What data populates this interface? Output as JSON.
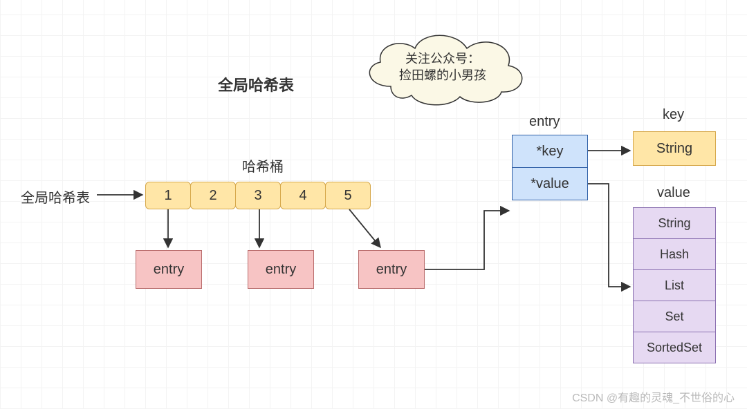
{
  "title": "全局哈希表",
  "cloud": {
    "line1": "关注公众号：",
    "line2": "捡田螺的小男孩"
  },
  "left_label": "全局哈希表",
  "bucket_label": "哈希桶",
  "buckets": [
    "1",
    "2",
    "3",
    "4",
    "5"
  ],
  "entries": [
    "entry",
    "entry",
    "entry"
  ],
  "entry_struct": {
    "heading": "entry",
    "key": "*key",
    "value": "*value"
  },
  "key": {
    "heading": "key",
    "type": "String"
  },
  "value": {
    "heading": "value",
    "types": [
      "String",
      "Hash",
      "List",
      "Set",
      "SortedSet"
    ]
  },
  "watermark": "CSDN @有趣的灵魂_不世俗的心"
}
